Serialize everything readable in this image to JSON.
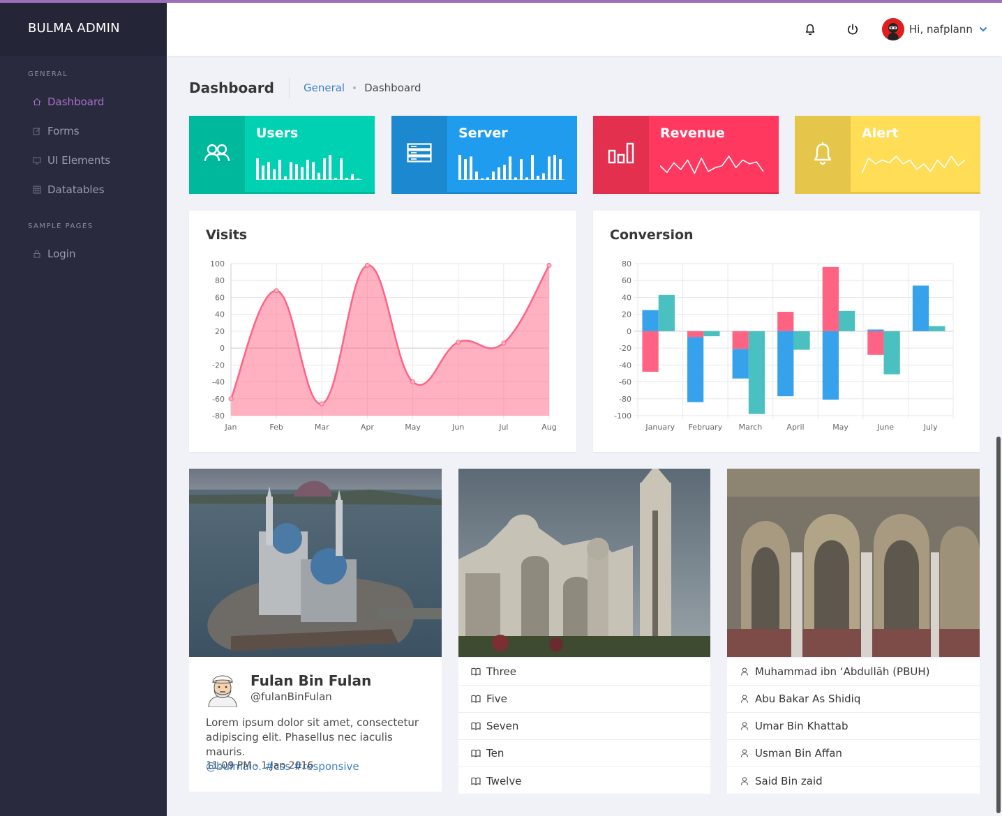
{
  "app": {
    "brand": "BULMA ADMIN",
    "accent": "#9c6fbb"
  },
  "sidebar": {
    "general_label": "GENERAL",
    "items": [
      {
        "label": "Dashboard",
        "icon": "home-icon",
        "active": true
      },
      {
        "label": "Forms",
        "icon": "edit-icon"
      },
      {
        "label": "UI Elements",
        "icon": "monitor-icon"
      },
      {
        "label": "Datatables",
        "icon": "table-icon"
      }
    ],
    "sample_label": "SAMPLE PAGES",
    "sample_items": [
      {
        "label": "Login",
        "icon": "lock-icon"
      }
    ]
  },
  "navbar": {
    "greeting": "Hi, nafplann",
    "icons": [
      "bell-icon",
      "power-icon",
      "chevron-down-icon"
    ]
  },
  "page": {
    "title": "Dashboard",
    "breadcrumb": [
      "General",
      "Dashboard"
    ]
  },
  "tiles": [
    {
      "name": "Users",
      "icon": "users-icon",
      "color": "#00d1b2",
      "dark": "#00b89c",
      "spark": [
        30,
        20,
        25,
        15,
        28,
        5,
        25,
        22,
        18,
        28,
        25,
        10,
        30,
        35,
        3,
        30,
        3,
        8,
        2
      ]
    },
    {
      "name": "Server",
      "icon": "server-icon",
      "color": "#209cee",
      "dark": "#1b88d0",
      "spark": [
        30,
        25,
        28,
        10,
        2,
        3,
        10,
        15,
        18,
        28,
        3,
        25,
        3,
        30,
        5,
        8,
        28,
        30,
        25
      ]
    },
    {
      "name": "Revenue",
      "icon": "bar-chart-icon",
      "color": "#ff3860",
      "dark": "#e4304f",
      "spark": [
        12,
        5,
        15,
        8,
        18,
        4,
        20,
        6,
        10,
        12,
        22,
        10,
        18,
        14,
        16,
        6
      ]
    },
    {
      "name": "Alert",
      "icon": "bell-icon",
      "color": "#ffdd57",
      "dark": "#e6c64a",
      "spark": [
        4,
        20,
        14,
        18,
        15,
        22,
        14,
        18,
        8,
        14,
        6,
        18,
        10,
        22,
        12,
        18
      ]
    }
  ],
  "visits": {
    "title": "Visits",
    "chart_data": {
      "type": "area",
      "categories": [
        "Jan",
        "Feb",
        "Mar",
        "Apr",
        "May",
        "Jun",
        "Jul",
        "Aug"
      ],
      "values": [
        -60,
        68,
        -66,
        98,
        -40,
        7,
        6,
        98
      ],
      "ylim": [
        -80,
        100
      ],
      "yticks": [
        100,
        80,
        60,
        40,
        20,
        0,
        -20,
        -40,
        -60,
        -80
      ],
      "color": "#ff6384",
      "grid": true
    }
  },
  "conversion": {
    "title": "Conversion",
    "chart_data": {
      "type": "bar",
      "categories": [
        "January",
        "February",
        "March",
        "April",
        "May",
        "June",
        "July"
      ],
      "stacked": true,
      "series": [
        {
          "values": [
            -48,
            -7,
            -21,
            23,
            76,
            -28,
            0
          ],
          "color": "#ff6384"
        },
        {
          "values": [
            25,
            -77,
            -35,
            -77,
            -81,
            2,
            54
          ],
          "color": "#36a2eb"
        },
        {
          "values": [
            43,
            -6,
            -98,
            -22,
            24,
            -51,
            6
          ],
          "color": "#4bc0c0"
        }
      ],
      "ylim": [
        -100,
        80
      ],
      "yticks": [
        80,
        60,
        40,
        20,
        0,
        -20,
        -40,
        -60,
        -80,
        -100
      ],
      "grid": true
    }
  },
  "profile": {
    "name": "Fulan Bin Fulan",
    "handle": "@fulanBinFulan",
    "text": "Lorem ipsum dolor sit amet, consectetur adipiscing elit. Phasellus nec iaculis mauris.",
    "links": [
      "@bulmaio.",
      "#css",
      "#responsive"
    ],
    "time": "11:09 PM - 1 Jan 2016"
  },
  "list_books": [
    "Three",
    "Five",
    "Seven",
    "Ten",
    "Twelve"
  ],
  "list_people": [
    "Muhammad ibn ‘Abdullāh (PBUH)",
    "Abu Bakar As Shidiq",
    "Umar Bin Khattab",
    "Usman Bin Affan",
    "Said Bin zaid"
  ]
}
